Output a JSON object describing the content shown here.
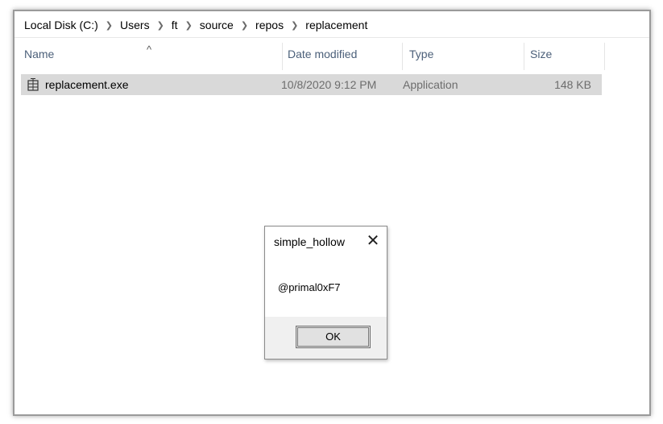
{
  "breadcrumb": [
    "Local Disk (C:)",
    "Users",
    "ft",
    "source",
    "repos",
    "replacement"
  ],
  "columns": {
    "name": "Name",
    "date_modified": "Date modified",
    "type": "Type",
    "size": "Size"
  },
  "files": [
    {
      "name": "replacement.exe",
      "date_modified": "10/8/2020 9:12 PM",
      "type": "Application",
      "size": "148 KB",
      "icon": "exe-file-icon"
    }
  ],
  "dialog": {
    "title": "simple_hollow",
    "message": "@primal0xF7",
    "ok_label": "OK"
  },
  "colors": {
    "header_text": "#4c607a",
    "selected_row": "#d9d9d9",
    "dialog_bg": "#f0f0f0"
  }
}
